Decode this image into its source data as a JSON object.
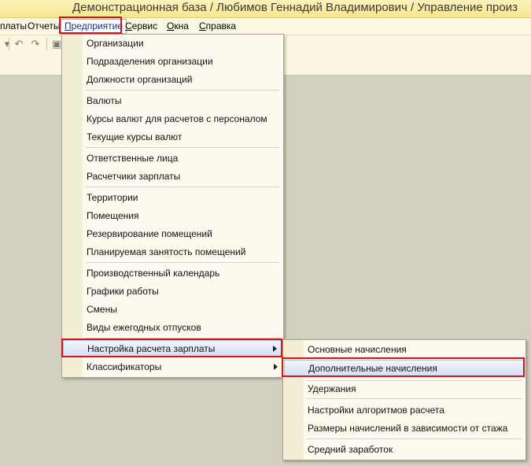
{
  "window": {
    "title": "Демонстрационная база / Любимов Геннадий Владимирович /  Управление произ"
  },
  "menubar": {
    "items": [
      {
        "label": "платы"
      },
      {
        "label": "Отчеты"
      },
      {
        "label": "Предприятие"
      },
      {
        "label": "Сервис"
      },
      {
        "label": "Окна"
      },
      {
        "label": "Справка"
      }
    ]
  },
  "enterprise_menu": {
    "items": [
      {
        "label": "Организации"
      },
      {
        "label": "Подразделения организации"
      },
      {
        "label": "Должности организаций"
      },
      {
        "label": "Валюты"
      },
      {
        "label": "Курсы валют для расчетов с персоналом"
      },
      {
        "label": "Текущие курсы валют"
      },
      {
        "label": "Ответственные лица"
      },
      {
        "label": "Расчетчики зарплаты"
      },
      {
        "label": "Территории"
      },
      {
        "label": "Помещения"
      },
      {
        "label": "Резервирование помещений"
      },
      {
        "label": "Планируемая занятость помещений"
      },
      {
        "label": "Производственный календарь"
      },
      {
        "label": "Графики работы"
      },
      {
        "label": "Смены"
      },
      {
        "label": "Виды ежегодных отпусков"
      },
      {
        "label": "Настройка расчета зарплаты",
        "submenu": true,
        "highlighted": true
      },
      {
        "label": "Классификаторы",
        "submenu": true
      }
    ]
  },
  "payroll_submenu": {
    "items": [
      {
        "label": "Основные начисления"
      },
      {
        "label": "Дополнительные начисления",
        "highlighted": true
      },
      {
        "label": "Удержания"
      },
      {
        "label": "Настройки алгоритмов расчета"
      },
      {
        "label": "Размеры начислений в зависимости от стажа"
      },
      {
        "label": "Средний заработок"
      }
    ]
  },
  "colors": {
    "highlight_box": "#d4141a",
    "menu_highlight": "#d2def1",
    "background": "#d4d0bf"
  }
}
